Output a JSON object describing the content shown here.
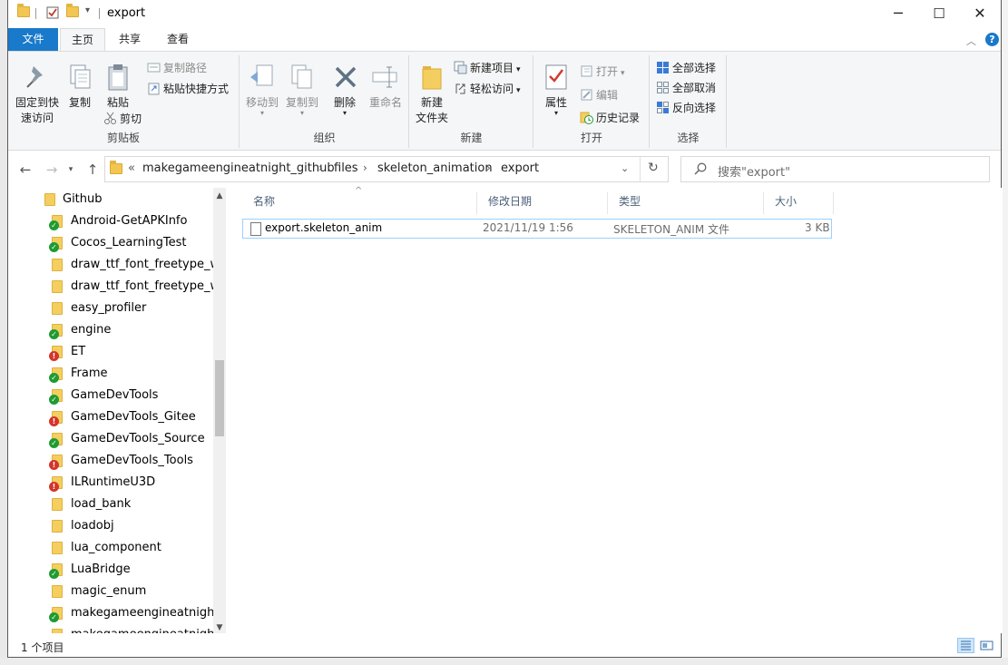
{
  "window": {
    "title": "export",
    "controls": {
      "minimize": "─",
      "maximize": "☐",
      "close": "✕"
    }
  },
  "tabs": {
    "file": "文件",
    "home": "主页",
    "share": "共享",
    "view": "查看"
  },
  "ribbon": {
    "clipboard": {
      "label": "剪贴板",
      "pin": "固定到快\n速访问",
      "pin_line1": "固定到快",
      "pin_line2": "速访问",
      "copy": "复制",
      "paste": "粘贴",
      "copy_path": "复制路径",
      "paste_shortcut": "粘贴快捷方式",
      "cut": "剪切"
    },
    "organize": {
      "label": "组织",
      "move_to": "移动到",
      "copy_to": "复制到",
      "delete": "删除",
      "rename": "重命名"
    },
    "new": {
      "label": "新建",
      "new_folder_line1": "新建",
      "new_folder_line2": "文件夹",
      "new_item": "新建项目",
      "easy_access": "轻松访问"
    },
    "open": {
      "label": "打开",
      "properties": "属性",
      "open": "打开",
      "edit": "编辑",
      "history": "历史记录"
    },
    "select": {
      "label": "选择",
      "select_all": "全部选择",
      "select_none": "全部取消",
      "invert": "反向选择"
    }
  },
  "address": {
    "overflow": "«",
    "crumbs": [
      "makegameengineatnight_github",
      "files",
      "skeleton_animation",
      "export"
    ],
    "search_placeholder": "搜索\"export\""
  },
  "tree": {
    "root": "Github",
    "items": [
      {
        "name": "Android-GetAPKInfo",
        "status": "ok"
      },
      {
        "name": "Cocos_LearningTest",
        "status": "ok"
      },
      {
        "name": "draw_ttf_font_freetype_wrap",
        "status": "none"
      },
      {
        "name": "draw_ttf_font_freetype_wrap",
        "status": "none"
      },
      {
        "name": "easy_profiler",
        "status": "none"
      },
      {
        "name": "engine",
        "status": "ok"
      },
      {
        "name": "ET",
        "status": "err"
      },
      {
        "name": "Frame",
        "status": "ok"
      },
      {
        "name": "GameDevTools",
        "status": "ok"
      },
      {
        "name": "GameDevTools_Gitee",
        "status": "err"
      },
      {
        "name": "GameDevTools_Source",
        "status": "ok"
      },
      {
        "name": "GameDevTools_Tools",
        "status": "err"
      },
      {
        "name": "ILRuntimeU3D",
        "status": "err"
      },
      {
        "name": "load_bank",
        "status": "none"
      },
      {
        "name": "loadobj",
        "status": "none"
      },
      {
        "name": "lua_component",
        "status": "none"
      },
      {
        "name": "LuaBridge",
        "status": "ok"
      },
      {
        "name": "magic_enum",
        "status": "none"
      },
      {
        "name": "makegameengineatnight",
        "status": "ok"
      },
      {
        "name": "makegameengineatnight_b",
        "status": "ok"
      }
    ]
  },
  "columns": {
    "name": "名称",
    "modified": "修改日期",
    "type": "类型",
    "size": "大小"
  },
  "files": [
    {
      "name": "export.skeleton_anim",
      "modified": "2021/11/19 1:56",
      "type": "SKELETON_ANIM 文件",
      "size": "3 KB"
    }
  ],
  "status": {
    "count": "1 个项目"
  },
  "colors": {
    "accent": "#1979ca",
    "selection_border": "#99d1ff",
    "folder": "#f4cf5f",
    "ok_badge": "#1f9b31",
    "err_badge": "#d3352b"
  }
}
